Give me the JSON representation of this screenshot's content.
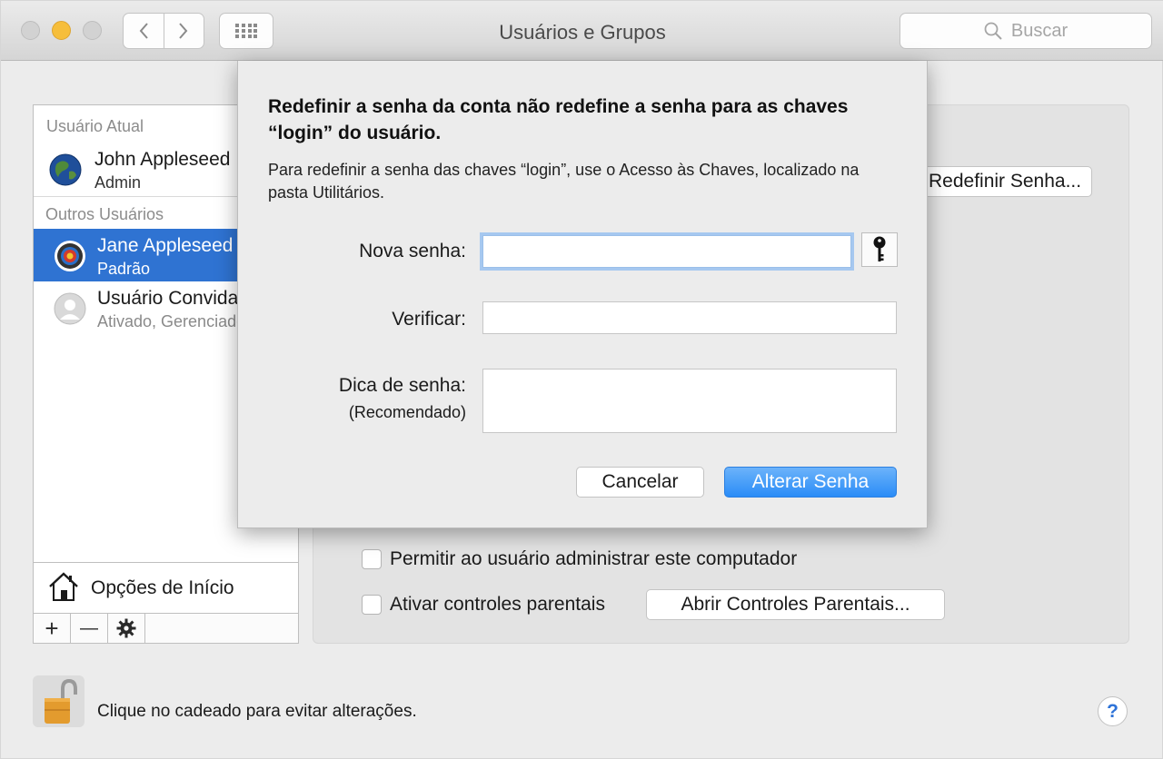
{
  "window": {
    "title": "Usuários e Grupos",
    "search_placeholder": "Buscar"
  },
  "sidebar": {
    "current_user_header": "Usuário Atual",
    "current_user": {
      "name": "John Appleseed",
      "role": "Admin"
    },
    "other_users_header": "Outros Usuários",
    "other_users": [
      {
        "name": "Jane Appleseed",
        "role": "Padrão",
        "selected": true
      },
      {
        "name": "Usuário Convidado",
        "role": "Ativado, Gerenciado",
        "selected": false
      }
    ],
    "login_options_label": "Opções de Início",
    "add_label": "+",
    "remove_label": "—"
  },
  "panel": {
    "reset_password_button": "Redefinir Senha...",
    "allow_admin_label": "Permitir ao usuário administrar este computador",
    "parental_controls_label": "Ativar controles parentais",
    "open_parental_button": "Abrir Controles Parentais..."
  },
  "footer": {
    "lock_text": "Clique no cadeado para evitar alterações.",
    "help_label": "?"
  },
  "sheet": {
    "title": "Redefinir a senha da conta não redefine a senha para as chaves “login” do usuário.",
    "description": "Para redefinir a senha das chaves “login”, use o Acesso às Chaves, localizado na pasta Utilitários.",
    "new_password_label": "Nova senha:",
    "new_password_value": "",
    "verify_label": "Verificar:",
    "verify_value": "",
    "hint_label": "Dica de senha:",
    "hint_sublabel": "(Recomendado)",
    "hint_value": "",
    "cancel_button": "Cancelar",
    "change_button": "Alterar Senha"
  },
  "colors": {
    "selection": "#2f73d2",
    "primary_button": "#2a8cf7",
    "focus_ring": "#a6c8f0",
    "minimize_light": "#f6be3b"
  }
}
